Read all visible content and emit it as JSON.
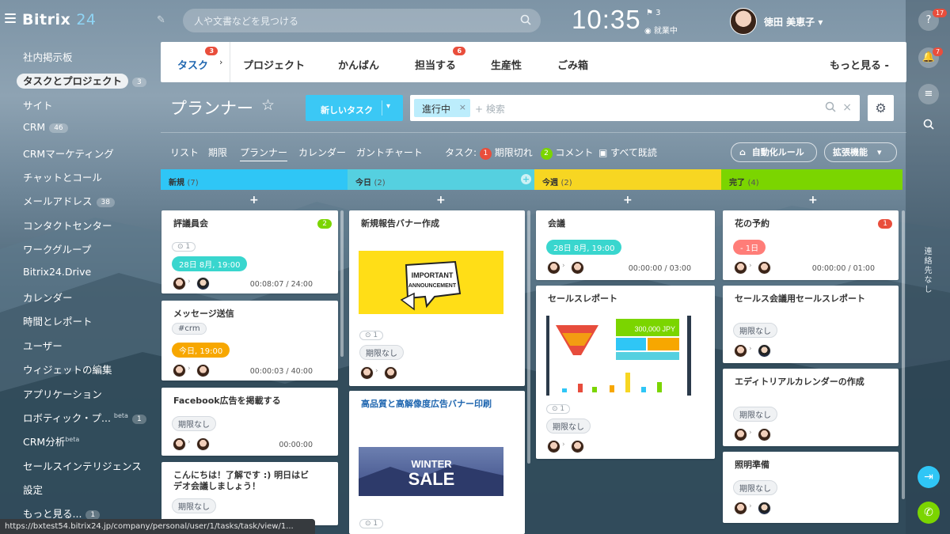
{
  "app": {
    "logo_main": "Bitrix",
    "logo_num": "24"
  },
  "search": {
    "placeholder": "人や文書などを見つける"
  },
  "clock": {
    "time": "10:35",
    "flag_count": "3",
    "status": "就業中"
  },
  "user": {
    "name": "徳田 美恵子"
  },
  "right_bar": {
    "help_badge": "17",
    "notif_badge": "7",
    "vertical_text": "連絡先なし"
  },
  "sidebar": {
    "items": [
      {
        "label": "社内掲示板"
      },
      {
        "label": "タスクとプロジェクト",
        "count": "3"
      },
      {
        "label": "サイト"
      },
      {
        "label": "CRM",
        "count": "46"
      },
      {
        "label": "CRMマーケティング"
      },
      {
        "label": "チャットとコール"
      },
      {
        "label": "メールアドレス",
        "count": "38"
      },
      {
        "label": "コンタクトセンター"
      },
      {
        "label": "ワークグループ"
      },
      {
        "label": "Bitrix24.Drive"
      },
      {
        "label": "カレンダー"
      },
      {
        "label": "時間とレポート"
      },
      {
        "label": "ユーザー"
      },
      {
        "label": "ウィジェットの編集"
      },
      {
        "label": "アプリケーション"
      },
      {
        "label": "ロボティック・プ...",
        "beta": "beta",
        "count": "1"
      },
      {
        "label": "CRM分析",
        "beta": "beta"
      },
      {
        "label": "セールスインテリジェンス"
      },
      {
        "label": "設定"
      },
      {
        "label": "もっと見る...",
        "count": "1"
      }
    ]
  },
  "statusbar": {
    "url": "https://bxtest54.bitrix24.jp/company/personal/user/1/tasks/task/view/1..."
  },
  "tabs": [
    {
      "label": "タスク",
      "badge": "3"
    },
    {
      "label": "プロジェクト"
    },
    {
      "label": "かんばん"
    },
    {
      "label": "担当する",
      "badge": "6"
    },
    {
      "label": "生産性"
    },
    {
      "label": "ごみ箱"
    },
    {
      "label": "もっと見る -"
    }
  ],
  "planner": {
    "title": "プランナー",
    "new_task": "新しいタスク",
    "filter_chip": "進行中",
    "filter_placeholder": "+ 検索"
  },
  "views": [
    "リスト",
    "期限",
    "プランナー",
    "カレンダー",
    "ガントチャート"
  ],
  "task_info": {
    "label": "タスク:",
    "overdue_count": "1",
    "overdue": "期限切れ",
    "comment_count": "2",
    "comment": "コメント",
    "read_all": "すべて既読"
  },
  "buttons": {
    "automation": "自動化ルール",
    "extensions": "拡張機能"
  },
  "columns": [
    {
      "name": "新規",
      "count": "(7)",
      "color": "#2fc6f6"
    },
    {
      "name": "今日",
      "count": "(2)",
      "color": "#55d0e0"
    },
    {
      "name": "今週",
      "count": "(2)",
      "color": "#f7d622"
    },
    {
      "name": "完了",
      "count": "(4)",
      "color": "#7bd500"
    }
  ],
  "cards": {
    "c1": {
      "title": "評議員会",
      "badge": "2",
      "checklist": "1",
      "deadline": "28日 8月, 19:00",
      "timer": "00:08:07 / 24:00"
    },
    "c2": {
      "title": "メッセージ送信",
      "tag": "#crm",
      "deadline": "今日, 19:00",
      "timer": "00:00:03 / 40:00"
    },
    "c3": {
      "title": "Facebook広告を掲載する",
      "deadline": "期限なし",
      "timer": "00:00:00"
    },
    "c4": {
      "title": "こんにちは！了解です :) 明日はビデオ会議しましょう！",
      "deadline": "期限なし"
    },
    "t1": {
      "title": "新規報告バナー作成",
      "image_text_1": "IMPORTANT",
      "image_text_2": "ANNOUNCEMENT",
      "checklist": "1",
      "deadline": "期限なし"
    },
    "t2": {
      "title": "高品質と高解像度広告バナー印刷",
      "image_text_1": "WINTER",
      "image_text_2": "SALE",
      "checklist": "1"
    },
    "w1": {
      "title": "会議",
      "deadline": "28日 8月, 19:00",
      "timer": "00:00:00 / 03:00"
    },
    "w2": {
      "title": "セールスレポート",
      "amount": "300,000 JPY",
      "checklist": "1",
      "deadline": "期限なし"
    },
    "d1": {
      "title": "花の予約",
      "badge": "1",
      "deadline": "- 1日",
      "timer": "00:00:00 / 01:00"
    },
    "d2": {
      "title": "セールス会議用セールスレポート",
      "deadline": "期限なし"
    },
    "d3": {
      "title": "エディトリアルカレンダーの作成",
      "deadline": "期限なし"
    },
    "d4": {
      "title": "照明準備",
      "deadline": "期限なし"
    }
  }
}
